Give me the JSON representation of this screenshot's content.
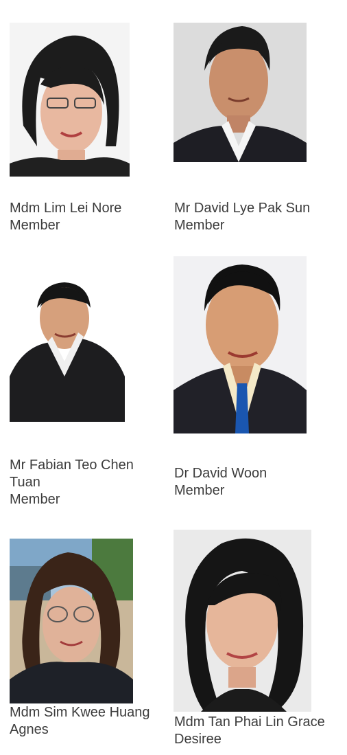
{
  "members": [
    {
      "name": "Mdm Lim Lei Nore",
      "role": "Member",
      "photo": "portrait-photo"
    },
    {
      "name": "Mr David Lye Pak Sun",
      "role": "Member",
      "photo": "portrait-photo"
    },
    {
      "name": "Mr Fabian Teo Chen Tuan",
      "role": "Member",
      "photo": "portrait-photo"
    },
    {
      "name": "Dr David Woon",
      "role": "Member",
      "photo": "portrait-photo"
    },
    {
      "name": "Mdm Sim Kwee Huang Agnes",
      "role": "",
      "photo": "portrait-photo"
    },
    {
      "name": "Mdm Tan Phai Lin Grace Desiree",
      "role": "",
      "photo": "portrait-photo"
    }
  ]
}
